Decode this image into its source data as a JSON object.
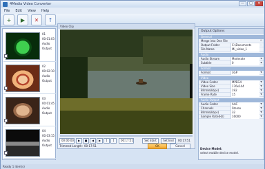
{
  "window": {
    "title": "4Media Video Converter",
    "controls": {
      "min": "—",
      "max": "□",
      "close": "✕"
    }
  },
  "menu": [
    "File",
    "Edit",
    "View",
    "Help"
  ],
  "toolbar": [
    {
      "icon": "add-file-icon",
      "glyph": "+"
    },
    {
      "icon": "convert-icon",
      "glyph": "▶"
    },
    {
      "icon": "remove-icon",
      "glyph": "✕"
    },
    {
      "icon": "up-icon",
      "glyph": "↑"
    }
  ],
  "files": [
    {
      "name": "01",
      "duration": "00:01:03",
      "size": "Audio",
      "codec": "Output"
    },
    {
      "name": "02",
      "duration": "00:02:10",
      "size": "Audio",
      "codec": "Output"
    },
    {
      "name": "03",
      "duration": "00:01:45",
      "size": "Audio",
      "codec": "Output"
    },
    {
      "name": "04",
      "duration": "00:03:15",
      "size": "Audio",
      "codec": "Output"
    }
  ],
  "preview": {
    "header": "Video Clip",
    "time_current": "00:00:00",
    "time_end": "00:17:51",
    "start_label": "Set Start",
    "end_label": "Set End",
    "trimmed_label": "Trimmed Length:",
    "trimmed_value": "00:17:51",
    "ok_label": "OK",
    "cancel_label": "Cancel"
  },
  "output_options": {
    "header": "Output Options",
    "sections": [
      {
        "title": "General",
        "rows": [
          {
            "k": "Merge into One File",
            "v": ""
          },
          {
            "k": "Output Folder",
            "v": "C:\\Documents"
          },
          {
            "k": "File Name",
            "v": "Mi_video_1"
          }
        ]
      },
      {
        "title": "Audio",
        "rows": [
          {
            "k": "Audio Stream",
            "v": "Moderate"
          },
          {
            "k": "Subtitle",
            "v": "0"
          }
        ]
      },
      {
        "title": "Format",
        "rows": [
          {
            "k": "Format",
            "v": "3GP"
          }
        ]
      },
      {
        "title": "Video",
        "rows": [
          {
            "k": "Video Codec",
            "v": "MPEG4"
          },
          {
            "k": "Video Size",
            "v": "176x144"
          },
          {
            "k": "Bitrate(kbps)",
            "v": "192"
          },
          {
            "k": "Frame Rate",
            "v": "15"
          }
        ]
      },
      {
        "title": "Audio Output",
        "rows": [
          {
            "k": "Audio Codec",
            "v": "AAC"
          },
          {
            "k": "Channels",
            "v": "Stereo"
          },
          {
            "k": "Bitrate(kbps)",
            "v": "32"
          },
          {
            "k": "Sample Rate(Hz)",
            "v": "16000"
          }
        ]
      }
    ],
    "description_title": "Device Model:",
    "description": "select mobile device model."
  },
  "status": "Ready   1 item(s)"
}
